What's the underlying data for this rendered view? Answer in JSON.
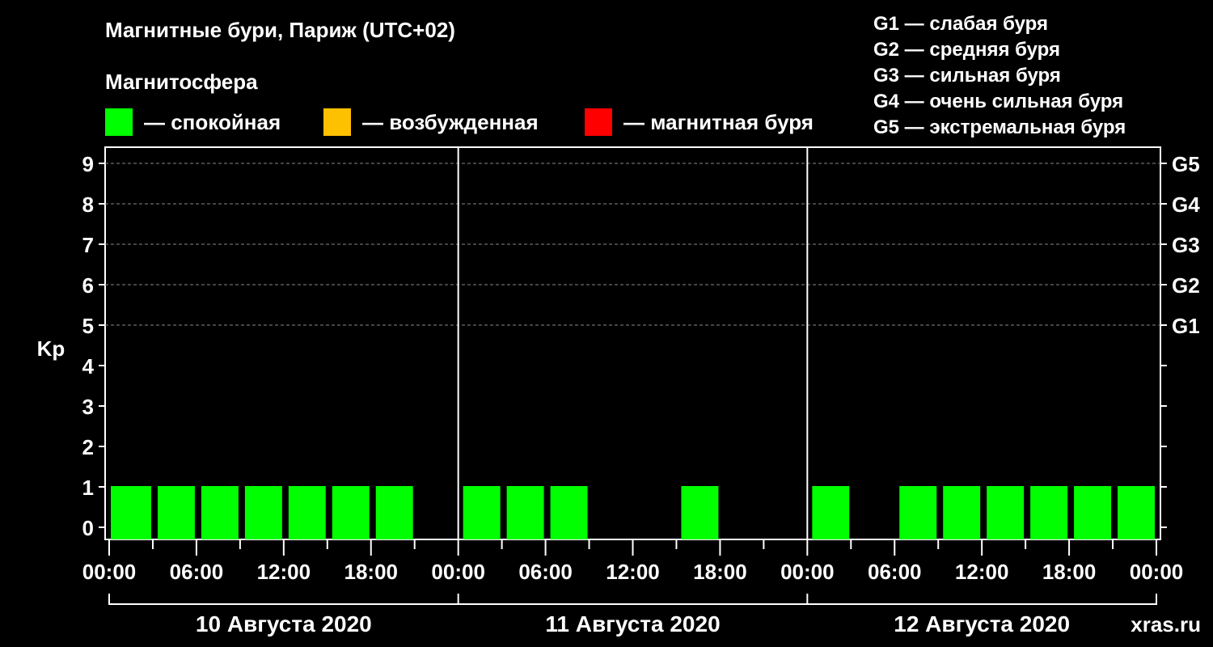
{
  "title": "Магнитные бури, Париж (UTC+02)",
  "subtitle": "Магнитосфера",
  "legend": [
    {
      "label": "— спокойная",
      "color": "#00ff00"
    },
    {
      "label": "— возбужденная",
      "color": "#ffc000"
    },
    {
      "label": "— магнитная буря",
      "color": "#ff0000"
    }
  ],
  "g_legend": [
    "G1 — слабая буря",
    "G2 — средняя буря",
    "G3 — сильная буря",
    "G4 — очень сильная буря",
    "G5 — экстремальная буря"
  ],
  "watermark": "xras.ru",
  "chart_data": {
    "type": "bar",
    "ylabel": "Kp",
    "ylim": [
      0,
      9
    ],
    "yticks": [
      "0",
      "1",
      "2",
      "3",
      "4",
      "5",
      "6",
      "7",
      "8",
      "9"
    ],
    "right_labels": [
      {
        "kp": 5,
        "label": "G1"
      },
      {
        "kp": 6,
        "label": "G2"
      },
      {
        "kp": 7,
        "label": "G3"
      },
      {
        "kp": 8,
        "label": "G4"
      },
      {
        "kp": 9,
        "label": "G5"
      }
    ],
    "xticks": [
      "00:00",
      "06:00",
      "12:00",
      "18:00",
      "00:00",
      "06:00",
      "12:00",
      "18:00",
      "00:00",
      "06:00",
      "12:00",
      "18:00",
      "00:00"
    ],
    "days": [
      "10 Августа 2020",
      "11 Августа 2020",
      "12 Августа 2020"
    ],
    "interval_hours": 3,
    "values": [
      1,
      1,
      1,
      1,
      1,
      1,
      1,
      0,
      1,
      1,
      1,
      0,
      0,
      1,
      0,
      0,
      1,
      0,
      1,
      1,
      1,
      1,
      1,
      1
    ],
    "bar_color": "#00ff00",
    "grid": true
  }
}
